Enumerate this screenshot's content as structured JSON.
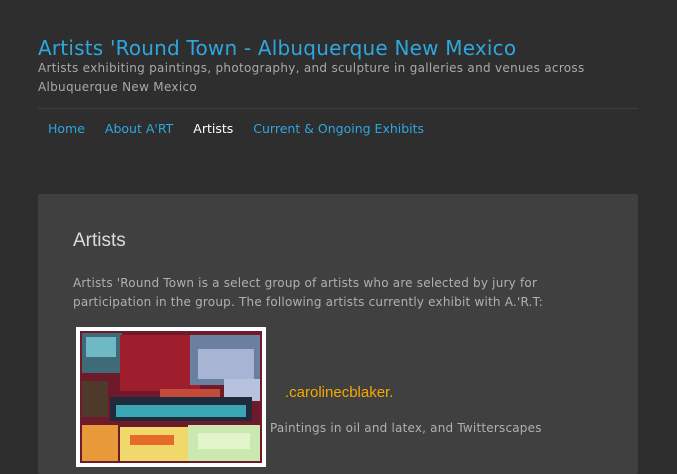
{
  "header": {
    "title": "Artists 'Round Town - Albuquerque New Mexico",
    "tagline": "Artists exhibiting paintings, photography, and sculpture in galleries and venues across Albuquerque New Mexico"
  },
  "nav": {
    "items": [
      {
        "label": "Home"
      },
      {
        "label": "About A'RT"
      },
      {
        "label": "Artists",
        "current": true
      },
      {
        "label": "Current & Ongoing Exhibits"
      }
    ]
  },
  "main": {
    "title": "Artists",
    "intro": "Artists 'Round Town is a select group of artists who are selected by jury for participation in the group. The following artists currently exhibit with A.'R.T:",
    "artists": [
      {
        "name": ".carolinecblaker.",
        "description": "Paintings in oil and latex, and Twitterscapes",
        "image_alt": "abstract painting thumbnail"
      }
    ]
  },
  "colors": {
    "background": "#2e2e2e",
    "content_panel": "#404040",
    "link": "#2ea7e0",
    "artist_link": "#f5a800"
  }
}
